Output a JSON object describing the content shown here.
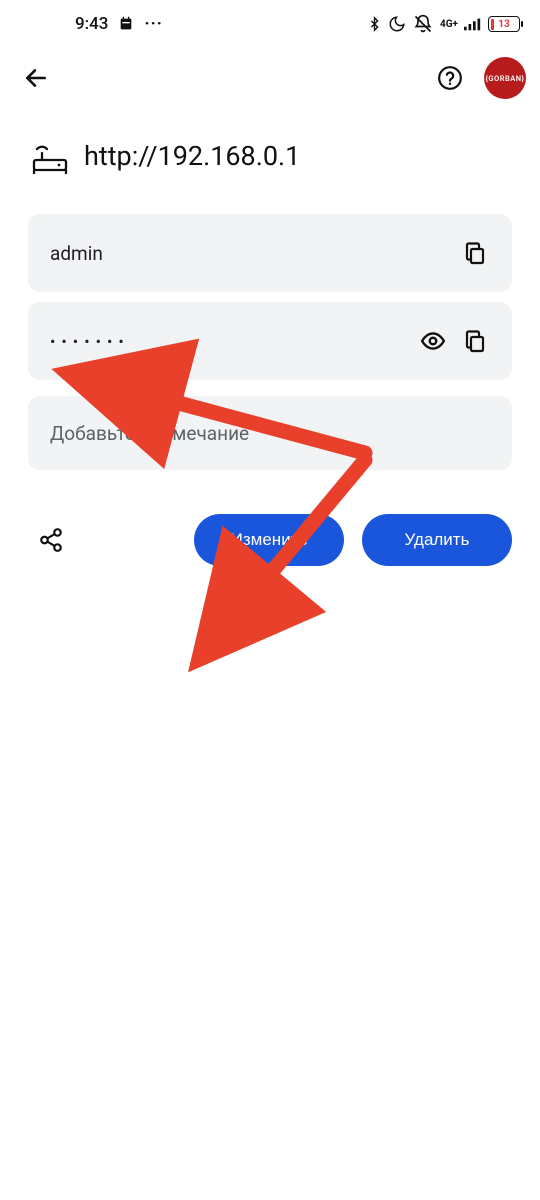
{
  "statusbar": {
    "time": "9:43",
    "net_label": "4G+",
    "battery_pct": "13"
  },
  "appbar": {
    "avatar_text": "{GORBAN}"
  },
  "page": {
    "url": "http://192.168.0.1"
  },
  "credentials": {
    "username": "admin",
    "password_masked": "•••••••"
  },
  "note": {
    "placeholder": "Добавьте примечание"
  },
  "actions": {
    "edit_label": "Изменить",
    "delete_label": "Удалить"
  }
}
